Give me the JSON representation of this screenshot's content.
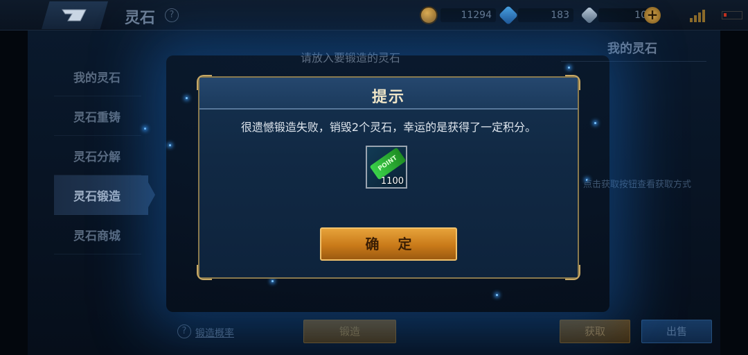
{
  "topbar": {
    "title": "灵石",
    "help_icon": "?",
    "coin_amount": "11294",
    "diamond_amount": "183",
    "gem_amount": "10",
    "add_icon": "+"
  },
  "nav": {
    "items": [
      {
        "label": "我的灵石"
      },
      {
        "label": "灵石重铸"
      },
      {
        "label": "灵石分解"
      },
      {
        "label": "灵石锻造"
      },
      {
        "label": "灵石商城"
      }
    ],
    "active_index": 3
  },
  "main": {
    "hint": "请放入要锻造的灵石",
    "right_title": "我的灵石",
    "right_hint": "点击获取按钮查看获取方式",
    "rate_help_icon": "?",
    "rate_link": "锻造概率",
    "forge_button": "锻造",
    "get_button": "获取",
    "sell_button": "出售"
  },
  "dialog": {
    "title": "提示",
    "message": "很遗憾锻造失败，销毁2个灵石，幸运的是获得了一定积分。",
    "reward_ticket_text": "POINT",
    "reward_count": "1100",
    "confirm_button": "确 定"
  },
  "colors": {
    "accent_gold": "#c97a19",
    "frame_gold": "#c7a865",
    "panel_blue": "#112944"
  }
}
